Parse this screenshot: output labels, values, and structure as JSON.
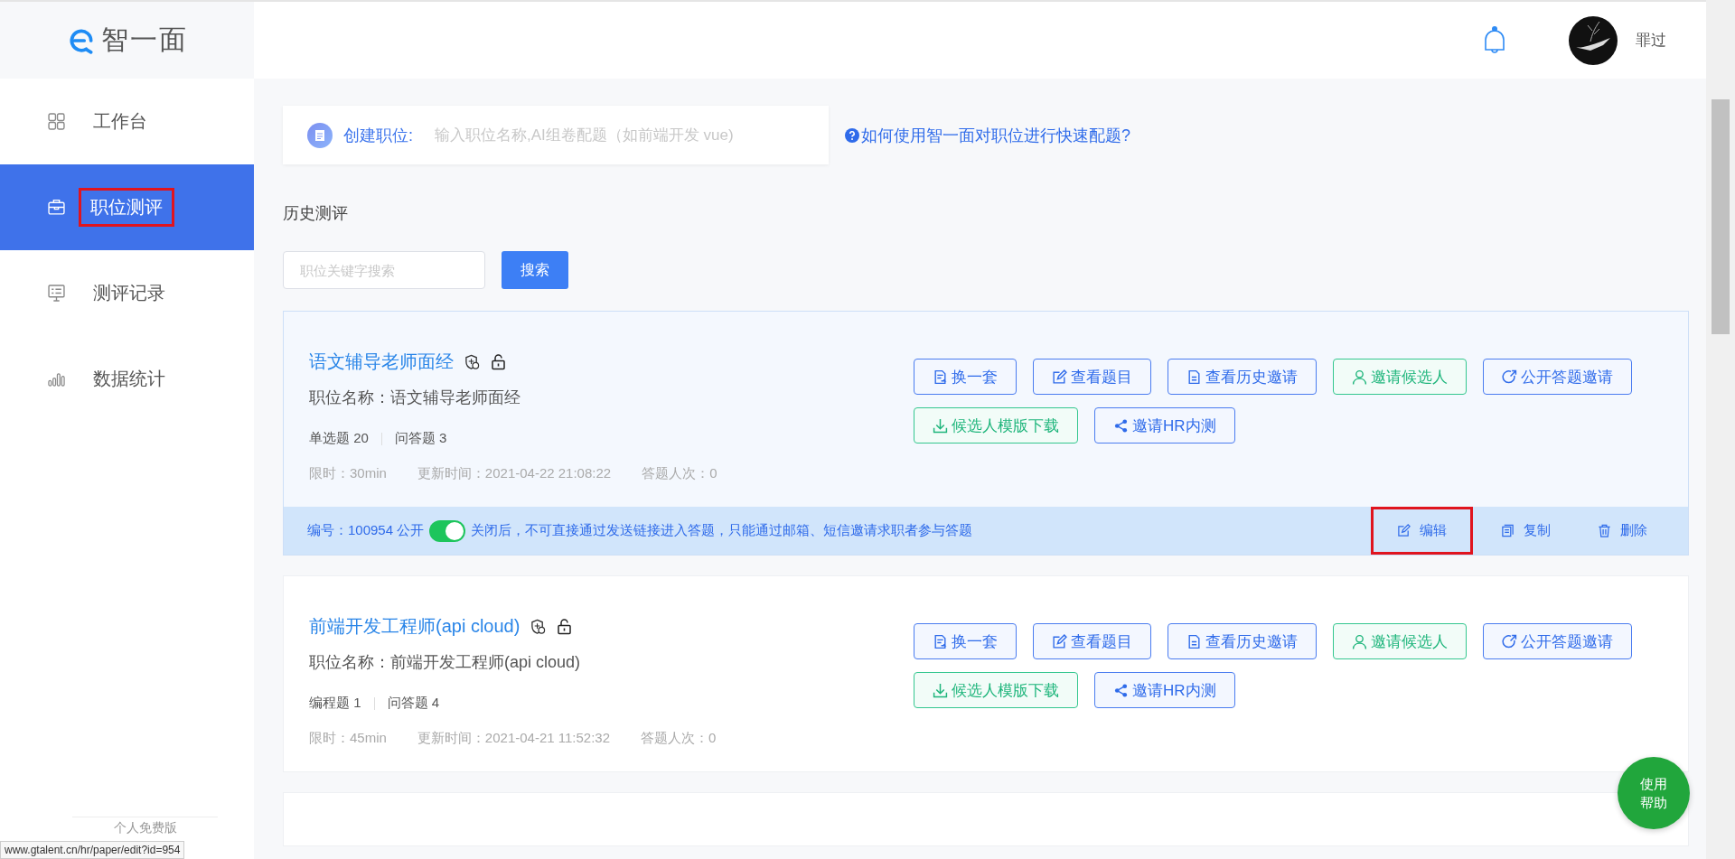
{
  "logo": {
    "text": "智一面"
  },
  "header": {
    "user_name": "罪过"
  },
  "nav": [
    {
      "label": "工作台",
      "selected": false,
      "annotated": false
    },
    {
      "label": "职位测评",
      "selected": true,
      "annotated": true
    },
    {
      "label": "测评记录",
      "selected": false,
      "annotated": false
    },
    {
      "label": "数据统计",
      "selected": false,
      "annotated": false
    }
  ],
  "sidebar_footer": "个人免费版",
  "create": {
    "label": "创建职位:",
    "placeholder": "输入职位名称,AI组卷配题（如前端开发 vue)"
  },
  "help_link": "如何使用智一面对职位进行快速配题?",
  "section_title": "历史测评",
  "search": {
    "placeholder": "职位关键字搜索",
    "button": "搜索"
  },
  "cards": [
    {
      "title": "语文辅导老师面经",
      "position": "职位名称：语文辅导老师面经",
      "hovered": true,
      "counts": [
        {
          "label": "单选题",
          "count": "20"
        },
        {
          "label": "问答题",
          "count": "3"
        }
      ],
      "meta": [
        "限时：30min",
        "更新时间：2021-04-22 21:08:22",
        "答题人次：0"
      ],
      "buttons": [
        {
          "label": "换一套",
          "kind": "blue"
        },
        {
          "label": "查看题目",
          "kind": "blue"
        },
        {
          "label": "查看历史邀请",
          "kind": "blue"
        },
        {
          "label": "邀请候选人",
          "kind": "green"
        },
        {
          "label": "公开答题邀请",
          "kind": "blue"
        },
        {
          "label": "候选人模版下载",
          "kind": "green"
        },
        {
          "label": "邀请HR内测",
          "kind": "blue"
        }
      ],
      "footer": {
        "id_text": "编号：100954 公开",
        "public": true,
        "hint": "关闭后，不可直接通过发送链接进入答题，只能通过邮箱、短信邀请求职者参与答题",
        "actions": [
          {
            "label": "编辑",
            "annotated": true
          },
          {
            "label": "复制",
            "annotated": false
          },
          {
            "label": "删除",
            "annotated": false
          }
        ]
      }
    },
    {
      "title": "前端开发工程师(api cloud)",
      "position": "职位名称：前端开发工程师(api cloud)",
      "hovered": false,
      "counts": [
        {
          "label": "编程题",
          "count": "1"
        },
        {
          "label": "问答题",
          "count": "4"
        }
      ],
      "meta": [
        "限时：45min",
        "更新时间：2021-04-21 11:52:32",
        "答题人次：0"
      ],
      "buttons": [
        {
          "label": "换一套",
          "kind": "blue"
        },
        {
          "label": "查看题目",
          "kind": "blue"
        },
        {
          "label": "查看历史邀请",
          "kind": "blue"
        },
        {
          "label": "邀请候选人",
          "kind": "green"
        },
        {
          "label": "公开答题邀请",
          "kind": "blue"
        },
        {
          "label": "候选人模版下载",
          "kind": "green"
        },
        {
          "label": "邀请HR内测",
          "kind": "blue"
        }
      ]
    }
  ],
  "help_button": "使用帮助",
  "status_url": "www.gtalent.cn/hr/paper/edit?id=954"
}
